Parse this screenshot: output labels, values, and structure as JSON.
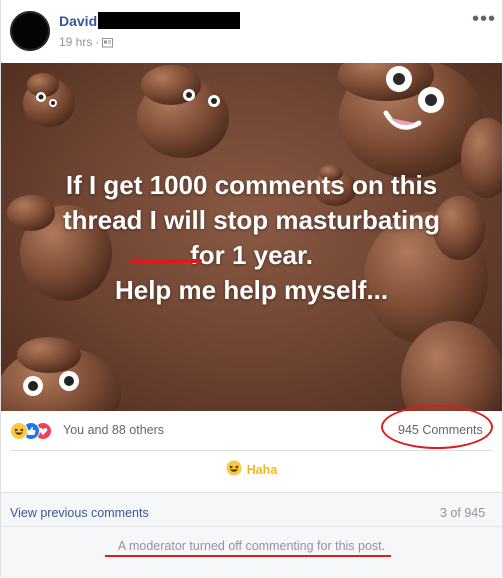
{
  "post": {
    "author": "David",
    "time": "19 hrs",
    "more_label": "•••"
  },
  "image": {
    "caption_lines": [
      "If I get 1000 comments on this",
      "thread I will stop masturbating",
      "for 1 year.",
      "Help me help myself..."
    ]
  },
  "reactions": {
    "summary": "You and 88 others",
    "types": [
      "haha",
      "like",
      "love"
    ],
    "comments_count": "945 Comments"
  },
  "actions": {
    "haha_label": "Haha"
  },
  "comments": {
    "view_previous": "View previous comments",
    "pager": "3 of 945",
    "closed_notice": "A moderator turned off commenting for this post."
  },
  "colors": {
    "link_blue": "#365899",
    "haha_yellow": "#f0ba15",
    "annotation_red": "#d81e1e"
  }
}
